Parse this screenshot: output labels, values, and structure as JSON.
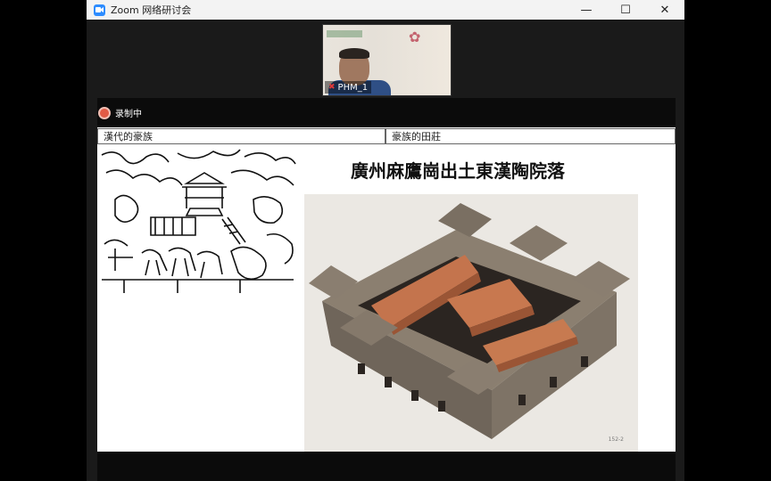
{
  "window": {
    "title": "Zoom 网络研讨会"
  },
  "window_controls": {
    "minimize": "—",
    "maximize": "☐",
    "close": "✕"
  },
  "participant": {
    "name": "PHM_1",
    "mic": "muted"
  },
  "recording": {
    "label": "录制中"
  },
  "slide": {
    "tabs": [
      {
        "label": "漢代的豪族"
      },
      {
        "label": "豪族的田莊"
      }
    ],
    "title": "廣州麻鷹崗出土東漢陶院落",
    "photo_label": "152-2"
  },
  "colors": {
    "zoom_blue": "#2d8cff",
    "record_red": "#e25b45"
  }
}
